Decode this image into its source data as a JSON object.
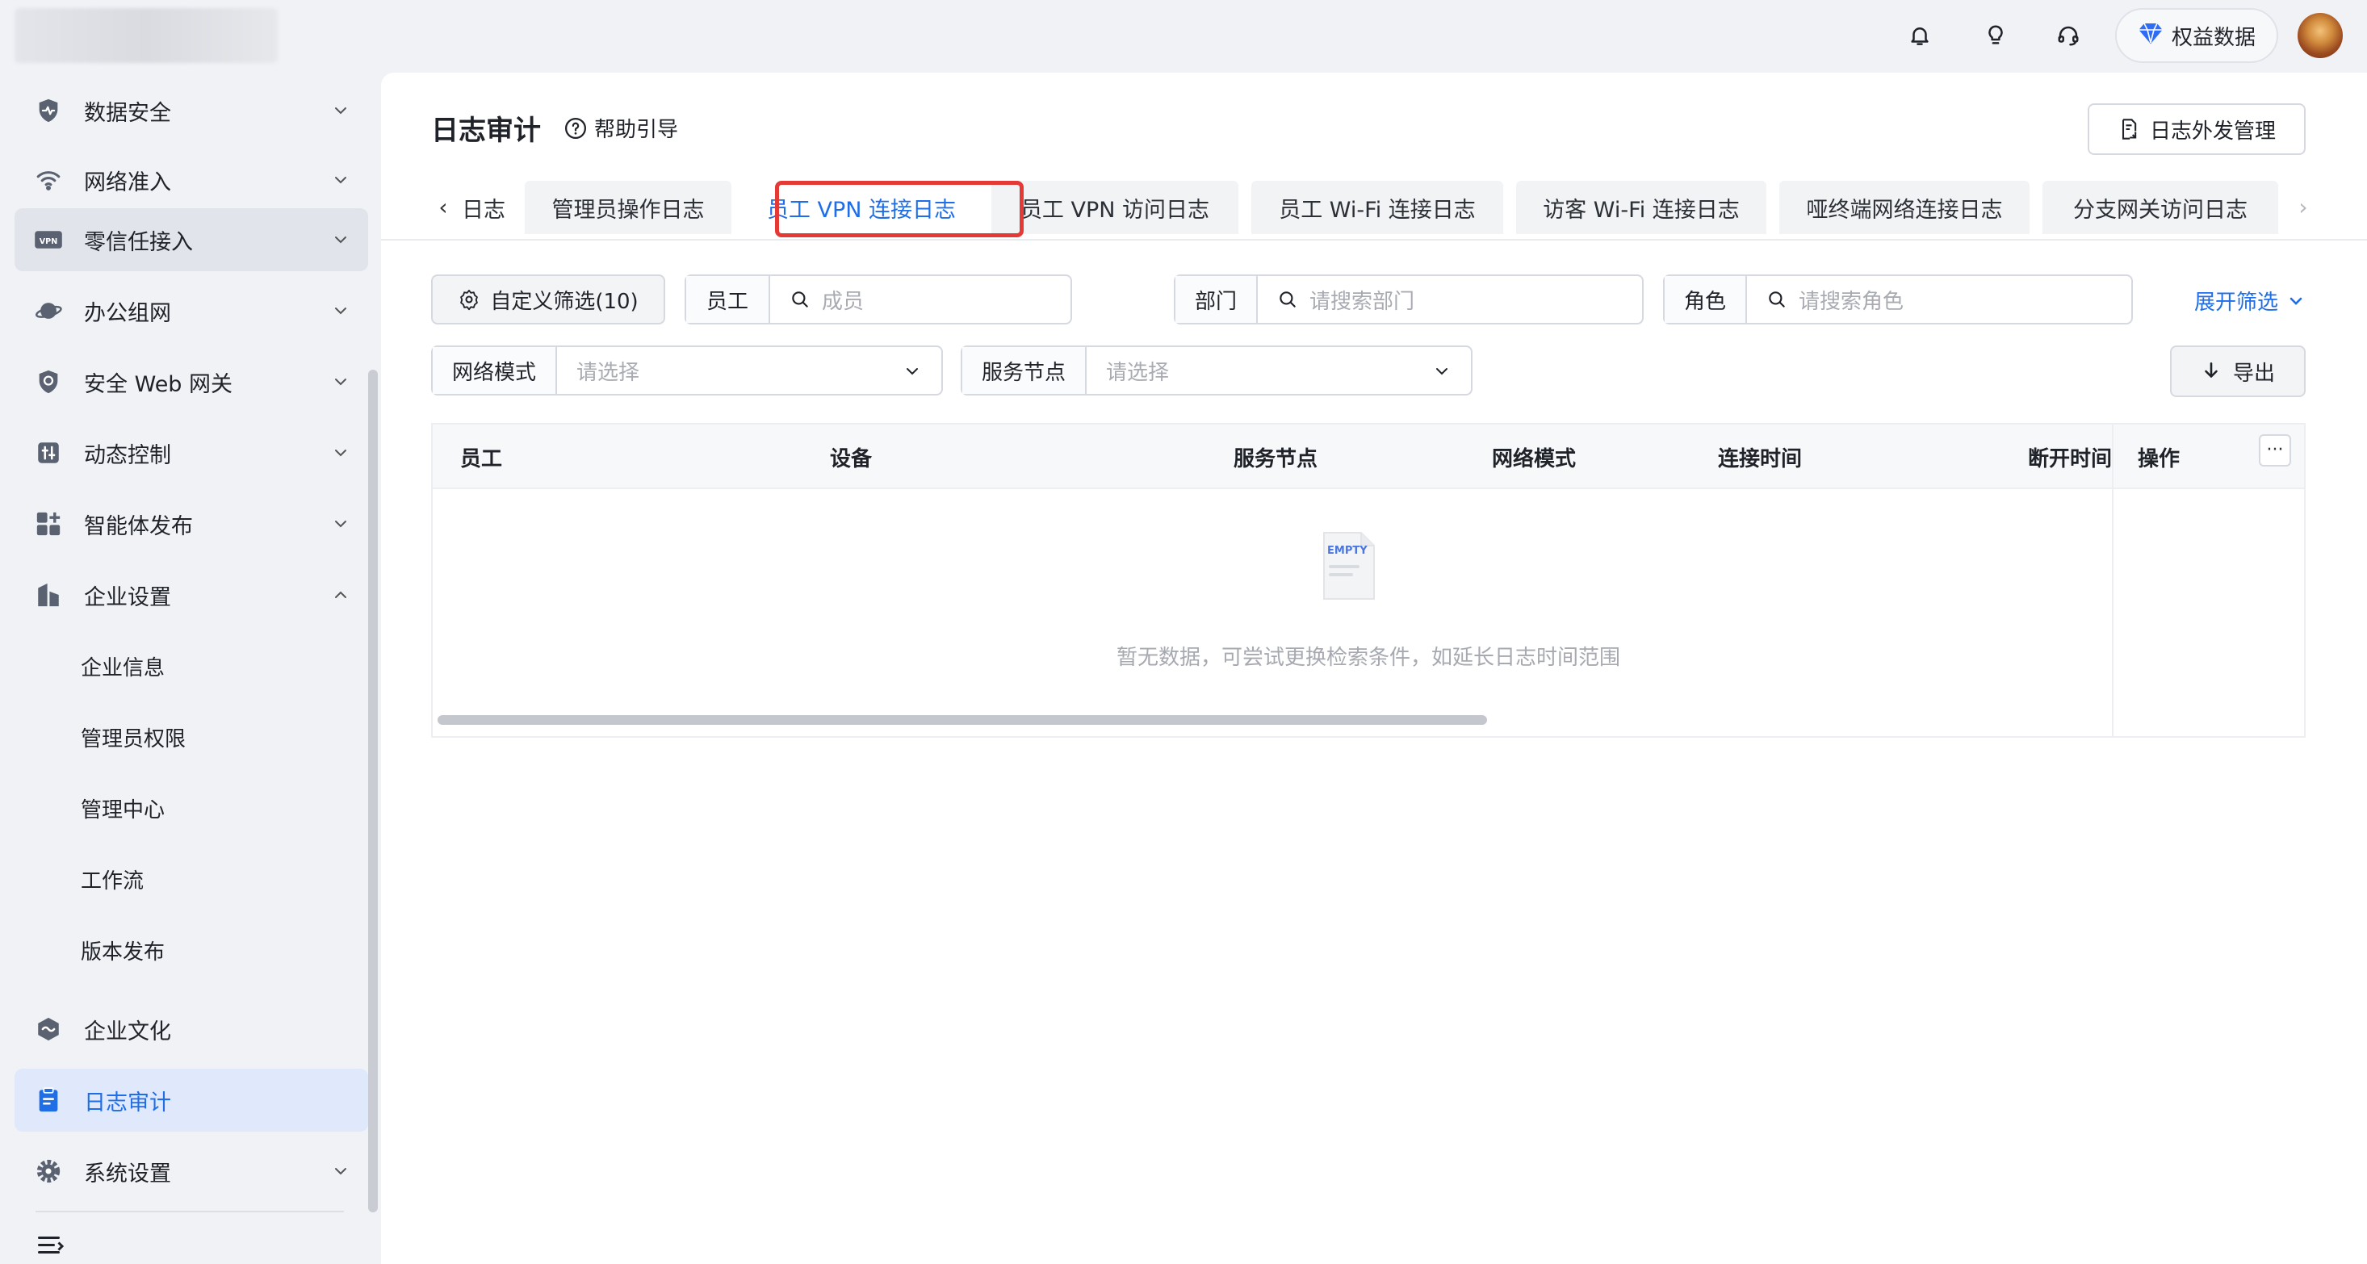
{
  "header": {
    "icons": [
      "bell-icon",
      "bulb-icon",
      "headset-icon"
    ],
    "rights_label": "权益数据",
    "rights_color": "#2f6cf6"
  },
  "sidebar": {
    "items": [
      {
        "label": "数据安全",
        "icon": "shield-pulse-icon"
      },
      {
        "label": "网络准入",
        "icon": "wifi-icon"
      },
      {
        "label": "零信任接入",
        "icon": "vpn-icon"
      },
      {
        "label": "办公组网",
        "icon": "planet-icon"
      },
      {
        "label": "安全 Web 网关",
        "icon": "shield-web-icon"
      },
      {
        "label": "动态控制",
        "icon": "dynamic-control-icon"
      },
      {
        "label": "智能体发布",
        "icon": "grid-plus-icon"
      },
      {
        "label": "企业设置",
        "icon": "building-icon"
      }
    ],
    "sub_items": [
      "企业信息",
      "管理员权限",
      "管理中心",
      "工作流",
      "版本发布"
    ],
    "bottom_items": [
      {
        "label": "企业文化",
        "icon": "culture-icon"
      },
      {
        "label": "日志审计",
        "icon": "log-audit-icon"
      },
      {
        "label": "系统设置",
        "icon": "gear-icon"
      }
    ]
  },
  "page": {
    "title": "日志审计",
    "help_label": "帮助引导",
    "log_out_label": "日志外发管理"
  },
  "tabs": [
    {
      "label": "日志"
    },
    {
      "label": "管理员操作日志"
    },
    {
      "label": "员工 VPN 连接日志"
    },
    {
      "label": "员工 VPN 访问日志"
    },
    {
      "label": "员工 Wi-Fi 连接日志"
    },
    {
      "label": "访客 Wi-Fi 连接日志"
    },
    {
      "label": "哑终端网络连接日志"
    },
    {
      "label": "分支网关访问日志"
    }
  ],
  "active_tab": "员工 VPN 连接日志",
  "filters": {
    "custom_filter_label": "自定义筛选(10)",
    "employee": {
      "label": "员工",
      "placeholder": "成员"
    },
    "department": {
      "label": "部门",
      "placeholder": "请搜索部门"
    },
    "role": {
      "label": "角色",
      "placeholder": "请搜索角色"
    },
    "expand_label": "展开筛选",
    "network_mode": {
      "label": "网络模式",
      "placeholder": "请选择"
    },
    "service_node": {
      "label": "服务节点",
      "placeholder": "请选择"
    },
    "export_label": "导出"
  },
  "table": {
    "columns": [
      "员工",
      "设备",
      "服务节点",
      "网络模式",
      "连接时间",
      "断开时间",
      "操作"
    ],
    "rows": [],
    "empty_image_text": "EMPTY",
    "empty_text": "暂无数据，可尝试更换检索条件，如延长日志时间范围"
  },
  "colors": {
    "accent": "#1f6ee8",
    "highlight_box": "#e53935"
  }
}
